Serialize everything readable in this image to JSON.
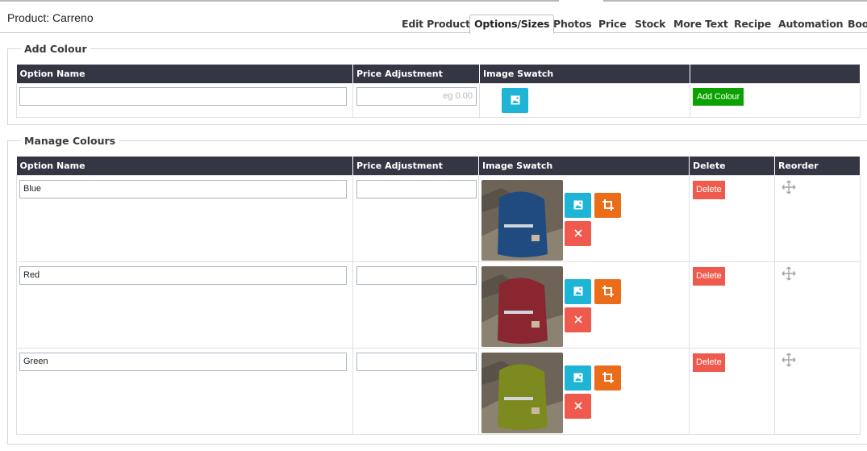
{
  "product": {
    "title": "Product: Carreno"
  },
  "tabs": [
    {
      "label": "Edit Product"
    },
    {
      "label": "Options/Sizes"
    },
    {
      "label": "Photos"
    },
    {
      "label": "Price"
    },
    {
      "label": "Stock"
    },
    {
      "label": "More Text"
    },
    {
      "label": "Recipe"
    },
    {
      "label": "Automation"
    },
    {
      "label": "Boo"
    }
  ],
  "active_tab": "Options/Sizes",
  "add_colour": {
    "legend": "Add Colour",
    "headers": {
      "option_name": "Option Name",
      "price_adjustment": "Price Adjustment",
      "image_swatch": "Image Swatch"
    },
    "option_value": "",
    "price_value": "",
    "price_placeholder": "eg 0.00",
    "add_button": "Add Colour"
  },
  "manage_colours": {
    "legend": "Manage Colours",
    "headers": {
      "option_name": "Option Name",
      "price_adjustment": "Price Adjustment",
      "image_swatch": "Image Swatch",
      "delete": "Delete",
      "reorder": "Reorder"
    },
    "delete_label": "Delete",
    "rows": [
      {
        "name": "Blue",
        "price": "",
        "swatch_color": "#1f4b80"
      },
      {
        "name": "Red",
        "price": "",
        "swatch_color": "#8a2630"
      },
      {
        "name": "Green",
        "price": "",
        "swatch_color": "#7d8a1f"
      }
    ]
  },
  "colors": {
    "header_bg": "#353643",
    "cyan_button": "#1eb4d6",
    "orange_button": "#eb6d1a",
    "red_button": "#ee5b4e",
    "green_button": "#0ba100"
  },
  "icons": {
    "image": "image-icon",
    "crop": "crop-icon",
    "remove": "close-icon",
    "reorder": "move-icon"
  }
}
